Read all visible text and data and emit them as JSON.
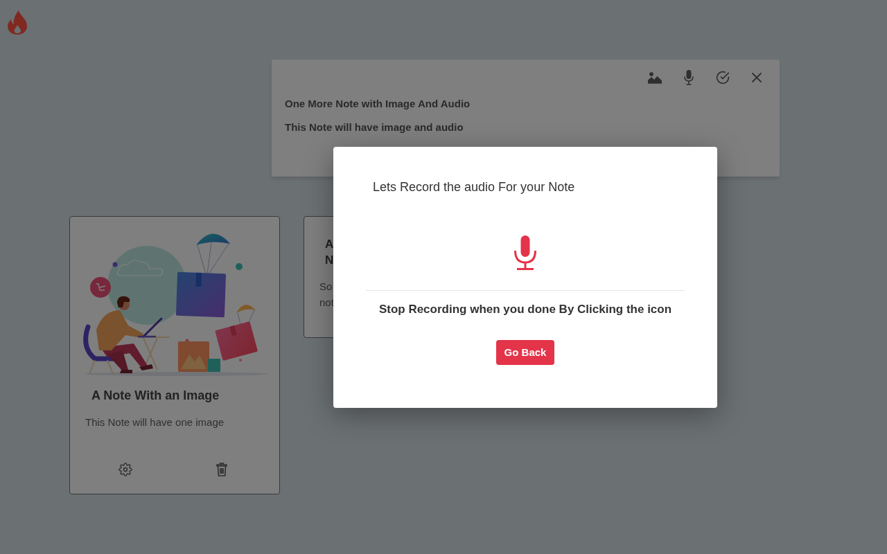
{
  "note_editor": {
    "title": "One More Note with Image And Audio",
    "body": "This Note will have image and audio"
  },
  "notes": [
    {
      "kind": "image",
      "title_lines": [
        "A Note With an Image"
      ],
      "body_lines": [
        "This Note will have one image"
      ]
    },
    {
      "kind": "text",
      "title_lines": [
        "A",
        "N"
      ],
      "body_lines": [
        "So",
        "not"
      ]
    }
  ],
  "dialog": {
    "title": "Lets Record the audio For your Note",
    "instruction": "Stop Recording when you done By Clicking the icon",
    "button": "Go Back"
  }
}
